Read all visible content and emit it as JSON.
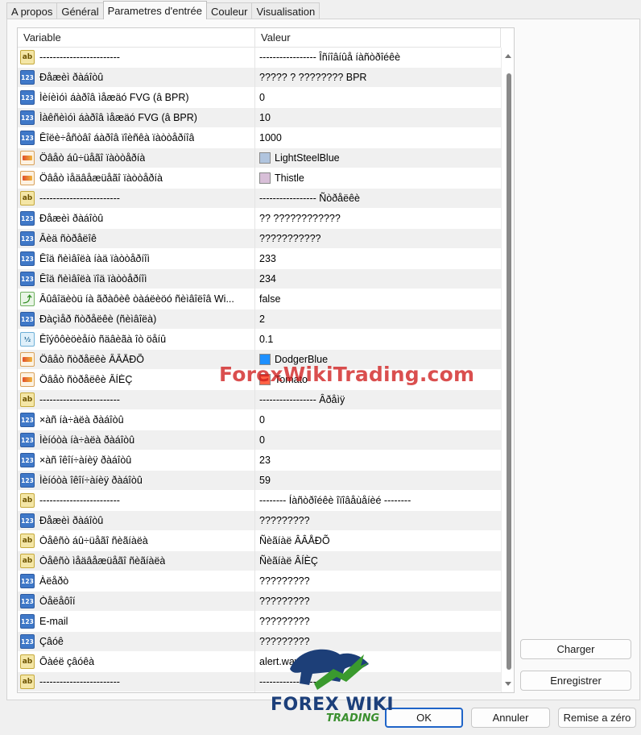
{
  "tabs": [
    "A propos",
    "Général",
    "Parametres d'entrée",
    "Couleur",
    "Visualisation"
  ],
  "active_tab": 2,
  "columns": {
    "variable": "Variable",
    "value": "Valeur"
  },
  "rows": [
    {
      "icon": "ab",
      "var": "------------------------",
      "val": "----------------- Îñíîâíûå íàñòðîéêè"
    },
    {
      "icon": "num",
      "var": "Ðåæèì ðàáîòû",
      "val": "????? ? ???????? BPR"
    },
    {
      "icon": "num",
      "var": "Ìèíèìóì áàðîâ ìåæäó FVG (â BPR)",
      "val": "0"
    },
    {
      "icon": "num",
      "var": "Ìàêñèìóì áàðîâ ìåæäó FVG (â BPR)",
      "val": "10"
    },
    {
      "icon": "num",
      "var": "Êîëè÷åñòâî áàðîâ ïîèñêà ïàòòåðíîâ",
      "val": "1000"
    },
    {
      "icon": "col",
      "var": "Öâåò áû÷üåãî ïàòòåðíà",
      "val": "LightSteelBlue",
      "swatch": "#b0c4de"
    },
    {
      "icon": "col",
      "var": "Öâåò ìåäâåæüåãî ïàòòåðíà",
      "val": "Thistle",
      "swatch": "#d8bfd8"
    },
    {
      "icon": "ab",
      "var": "------------------------",
      "val": "----------------- Ñòðåëêè"
    },
    {
      "icon": "num",
      "var": "Ðåæèì ðàáîòû",
      "val": "?? ????????????"
    },
    {
      "icon": "num",
      "var": "Âèä ñòðåëîê",
      "val": "???????????"
    },
    {
      "icon": "num",
      "var": "Êîä ñèìâîëà íàä ïàòòåðíîì",
      "val": "233"
    },
    {
      "icon": "num",
      "var": "Êîä ñèìâîëà ïîä ïàòòåðíîì",
      "val": "234"
    },
    {
      "icon": "bool",
      "var": "Âûâîäèòü íà ãðàôèê òàáëèöó ñèìâîëîâ Wi...",
      "val": "false"
    },
    {
      "icon": "num",
      "var": "Ðàçìåð ñòðåëêè (ñèìâîëà)",
      "val": "2"
    },
    {
      "icon": "half",
      "var": "Êîýôôèöèåíò ñäâèãà îò öåíû",
      "val": "0.1"
    },
    {
      "icon": "col",
      "var": "Öâåò ñòðåëêè ÂÂÅÐÕ",
      "val": "DodgerBlue",
      "swatch": "#1e90ff"
    },
    {
      "icon": "col",
      "var": "Öâåò ñòðåëêè ÂÍÈÇ",
      "val": "Tomato",
      "swatch": "#ff6347"
    },
    {
      "icon": "ab",
      "var": "------------------------",
      "val": "----------------- Âðåìÿ"
    },
    {
      "icon": "num",
      "var": "×àñ íà÷àëà ðàáîòû",
      "val": "0"
    },
    {
      "icon": "num",
      "var": "Ìèíóòà íà÷àëà ðàáîòû",
      "val": "0"
    },
    {
      "icon": "num",
      "var": "×àñ îêîí÷àíèÿ ðàáîòû",
      "val": "23"
    },
    {
      "icon": "num",
      "var": "Ìèíóòà îêîí÷àíèÿ ðàáîòû",
      "val": "59"
    },
    {
      "icon": "ab",
      "var": "------------------------",
      "val": "-------- Íàñòðîéêè îïîâåùåíèé --------"
    },
    {
      "icon": "num",
      "var": "Ðåæèì ðàáîòû",
      "val": "?????????"
    },
    {
      "icon": "ab",
      "var": "Òåêñò áû÷üåãî ñèãíàëà",
      "val": "Ñèãíàë   ÂÂÅÐÕ"
    },
    {
      "icon": "ab",
      "var": "Òåêñò ìåäâåæüåãî ñèãíàëà",
      "val": "Ñèãíàë   ÂÍÈÇ"
    },
    {
      "icon": "num",
      "var": "Àëåðò",
      "val": "?????????"
    },
    {
      "icon": "num",
      "var": "Òåëåôîí",
      "val": "?????????"
    },
    {
      "icon": "num",
      "var": "E-mail",
      "val": "?????????"
    },
    {
      "icon": "num",
      "var": "Çâóê",
      "val": "?????????"
    },
    {
      "icon": "ab",
      "var": "Ôàéë çâóêà",
      "val": "alert.wav"
    },
    {
      "icon": "ab",
      "var": "------------------------",
      "val": "--------------------"
    }
  ],
  "buttons": {
    "load": "Charger",
    "save": "Enregistrer",
    "ok": "OK",
    "cancel": "Annuler",
    "reset": "Remise a zéro"
  },
  "watermark": "ForexWikiTrading.com",
  "logo": {
    "brand": "FOREX WIKI",
    "sub": "TRADING"
  }
}
